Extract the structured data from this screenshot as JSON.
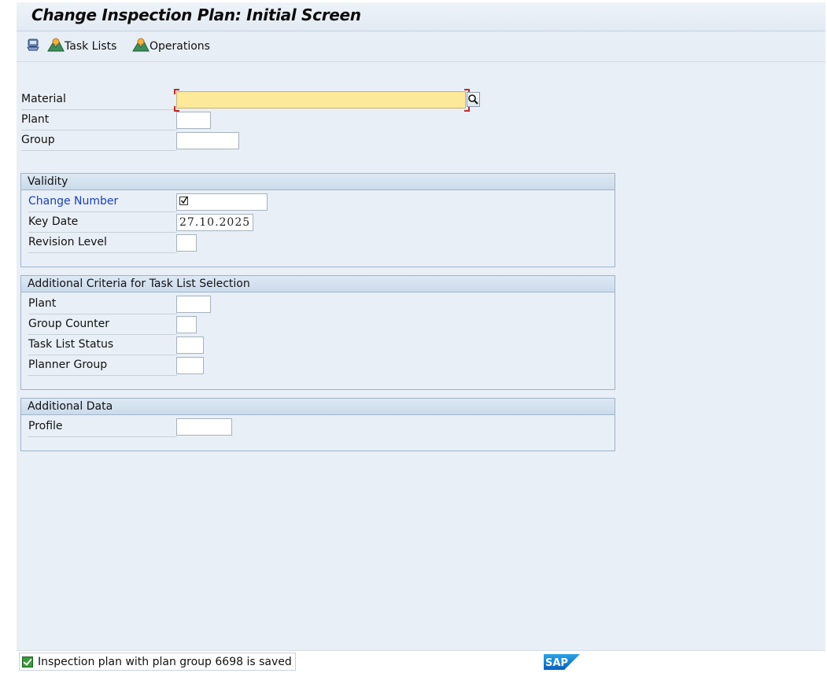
{
  "window": {
    "title": "Change Inspection Plan: Initial Screen"
  },
  "toolbar": {
    "items": [
      {
        "icon": "other-objects-icon",
        "label": ""
      },
      {
        "icon": "task-lists-icon",
        "label": "Task Lists"
      },
      {
        "icon": "operations-icon",
        "label": "Operations"
      }
    ]
  },
  "header_fields": {
    "material": {
      "label": "Material",
      "value": ""
    },
    "plant": {
      "label": "Plant",
      "value": ""
    },
    "group": {
      "label": "Group",
      "value": ""
    }
  },
  "validity": {
    "title": "Validity",
    "change_number": {
      "label": "Change Number",
      "value": ""
    },
    "key_date": {
      "label": "Key Date",
      "value": "27.10.2025"
    },
    "revision_level": {
      "label": "Revision Level",
      "value": ""
    }
  },
  "additional_criteria": {
    "title": "Additional Criteria for Task List Selection",
    "plant": {
      "label": "Plant",
      "value": ""
    },
    "group_counter": {
      "label": "Group Counter",
      "value": ""
    },
    "task_list_status": {
      "label": "Task List Status",
      "value": ""
    },
    "planner_group": {
      "label": "Planner Group",
      "value": ""
    }
  },
  "additional_data": {
    "title": "Additional Data",
    "profile": {
      "label": "Profile",
      "value": ""
    }
  },
  "status": {
    "message": "Inspection plan with plan group 6698 is saved",
    "type": "success",
    "logo_text": "SAP"
  },
  "colors": {
    "required_field": "#fde99a",
    "link_label": "#1a3fbf",
    "success": "#3a9b3a",
    "sap_blue": "#0a6ed1"
  }
}
